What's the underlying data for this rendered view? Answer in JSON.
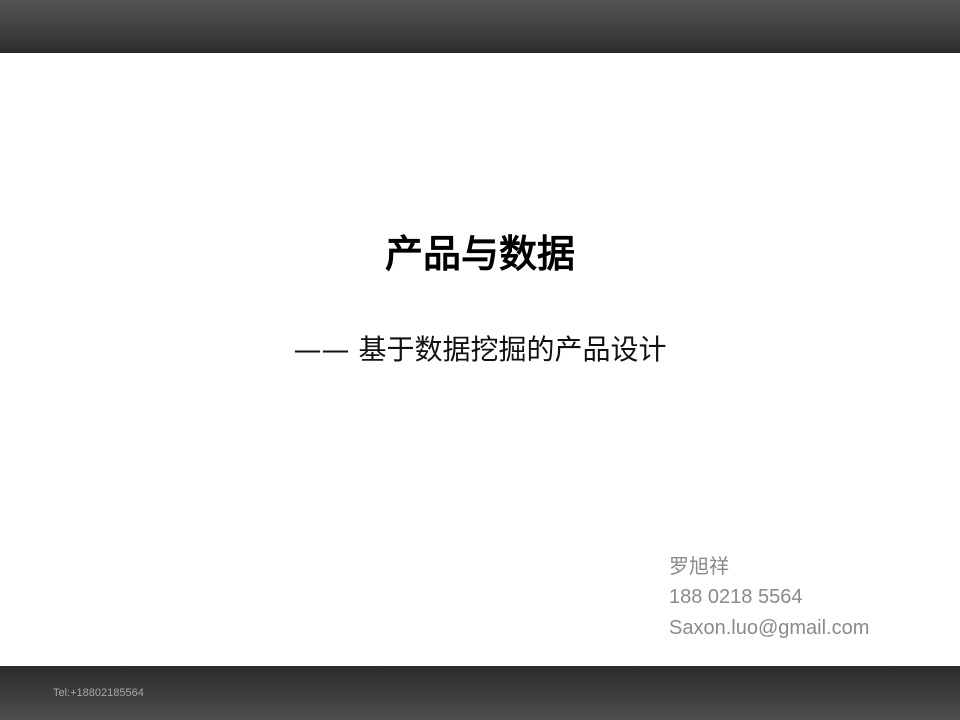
{
  "slide": {
    "title": "产品与数据",
    "subtitle": "—— 基于数据挖掘的产品设计",
    "author": {
      "name": "罗旭祥",
      "phone": "188 0218 5564",
      "email": "Saxon.luo@gmail.com"
    },
    "footer": {
      "tel": "Tel:+18802185564"
    }
  },
  "colors": {
    "bar_dark": "#3e3e3e",
    "title_text": "#000000",
    "author_text": "#8a8a8a",
    "footer_text": "#a8a8a8"
  }
}
